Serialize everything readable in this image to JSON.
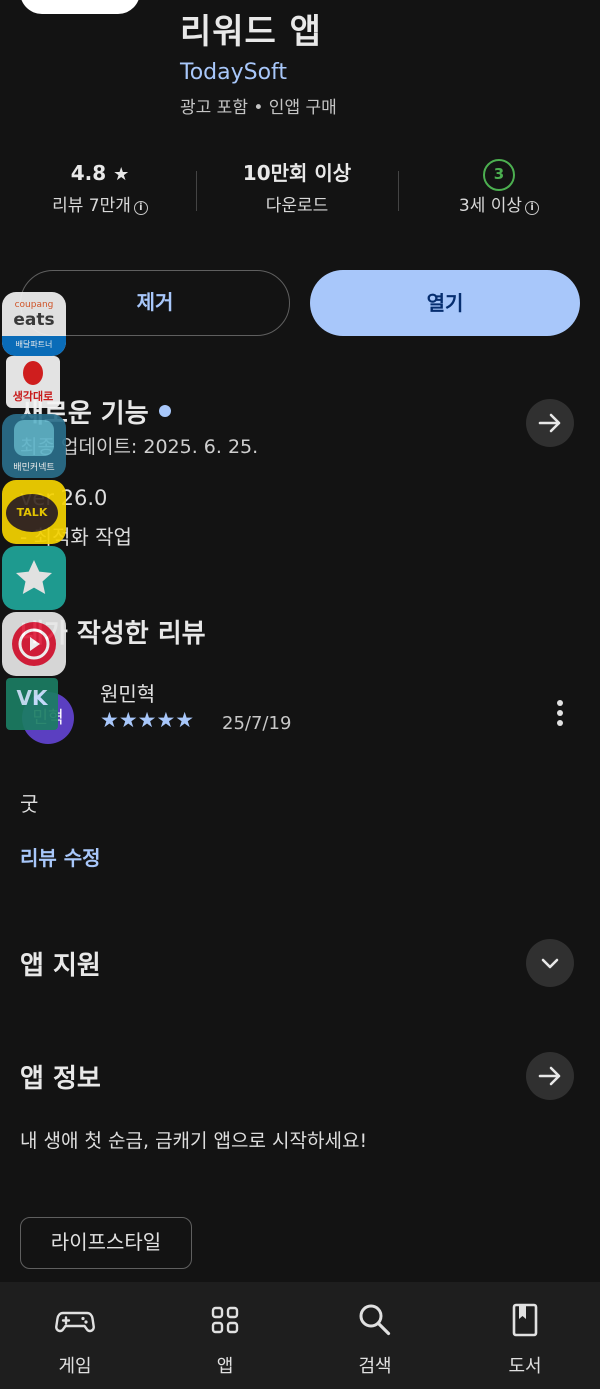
{
  "app": {
    "title": "리워드 앱",
    "developer": "TodaySoft",
    "meta": "광고 포함 • 인앱 구매"
  },
  "stats": {
    "rating": "4.8",
    "rating_star": "★",
    "reviews_label": "리뷰 7만개",
    "downloads": "10만회 이상",
    "downloads_label": "다운로드",
    "age_badge": "3",
    "age_label": "3세 이상"
  },
  "buttons": {
    "remove": "제거",
    "open": "열기"
  },
  "whats_new": {
    "title": "새로운 기능",
    "updated": "최종 업데이트: 2025. 6. 25.",
    "version": "ver 26.0",
    "note": "- 최적화 작업"
  },
  "my_review": {
    "title": "내가 작성한 리뷰",
    "reviewer": "원민혁",
    "avatar_text": "민혁",
    "stars": "★★★★★",
    "rating_value": 5,
    "date": "25/7/19",
    "text": "굿",
    "edit_link": "리뷰 수정"
  },
  "app_support": {
    "title": "앱 지원"
  },
  "app_info": {
    "title": "앱 정보",
    "description": "내 생애 첫 순금, 금캐기 앱으로 시작하세요!",
    "category_chip": "라이프스타일"
  },
  "floating_apps": {
    "coupang_brand": "coupang",
    "coupang_eats": "eats",
    "coupang_sub": "배달파트너",
    "app2_label": "생각대로",
    "app3_label": "배민커넥트",
    "kakao_label": "TALK",
    "vk_label": "VK"
  },
  "nav": {
    "items": [
      {
        "label": "게임",
        "icon": "gamepad-icon"
      },
      {
        "label": "앱",
        "icon": "apps-grid-icon"
      },
      {
        "label": "검색",
        "icon": "search-icon"
      },
      {
        "label": "도서",
        "icon": "book-icon"
      }
    ]
  },
  "colors": {
    "background": "#131313",
    "accent": "#a8c7fa",
    "age_badge": "#4caf50",
    "nav_background": "#1e1e1e"
  }
}
